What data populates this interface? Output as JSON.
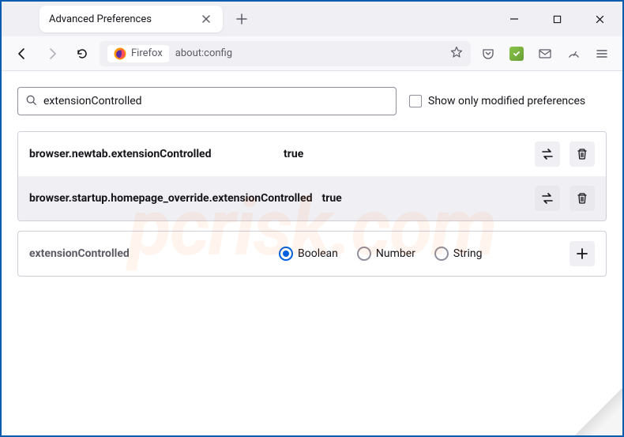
{
  "titlebar": {
    "tab_title": "Advanced Preferences"
  },
  "toolbar": {
    "identity_label": "Firefox",
    "url": "about:config"
  },
  "search": {
    "value": "extensionControlled",
    "checkbox_label": "Show only modified preferences"
  },
  "prefs": [
    {
      "name": "browser.newtab.extensionControlled",
      "value": "true"
    },
    {
      "name": "browser.startup.homepage_override.extensionControlled",
      "value": "true"
    }
  ],
  "add_row": {
    "name": "extensionControlled",
    "types": [
      "Boolean",
      "Number",
      "String"
    ],
    "selected": "Boolean"
  },
  "watermark": "pcrisk.com"
}
